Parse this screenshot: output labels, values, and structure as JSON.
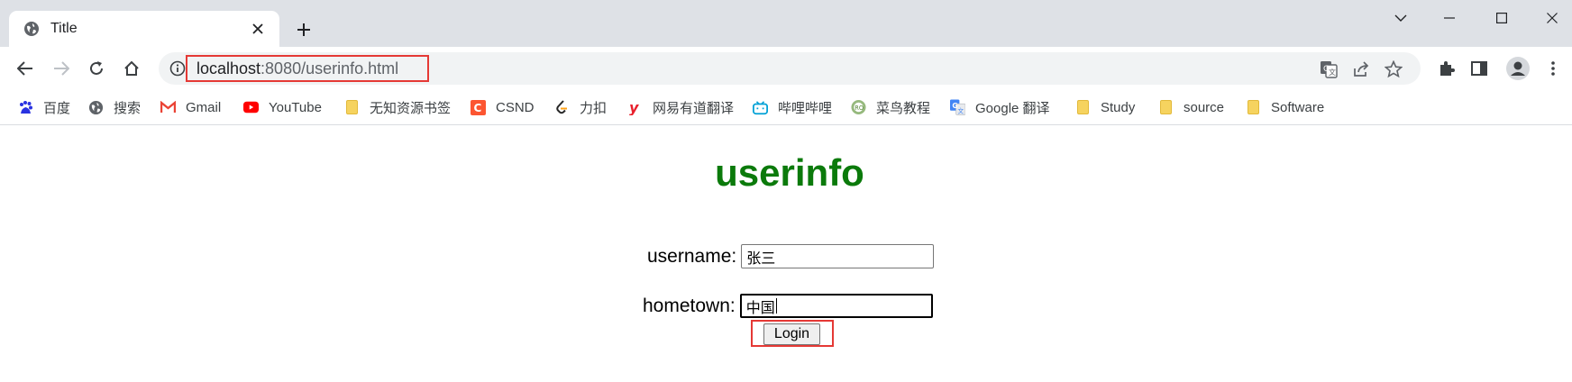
{
  "tab": {
    "title": "Title"
  },
  "address_bar": {
    "host": "localhost",
    "rest": ":8080/userinfo.html"
  },
  "bookmarks": [
    {
      "label": "百度",
      "icon": "baidu-icon"
    },
    {
      "label": "搜索",
      "icon": "globe-icon"
    },
    {
      "label": "Gmail",
      "icon": "gmail-icon"
    },
    {
      "label": "YouTube",
      "icon": "youtube-icon"
    },
    {
      "label": "无知资源书签",
      "icon": "folder-icon"
    },
    {
      "label": "CSND",
      "icon": "csdn-icon"
    },
    {
      "label": "力扣",
      "icon": "leetcode-icon"
    },
    {
      "label": "网易有道翻译",
      "icon": "youdao-icon"
    },
    {
      "label": "哔哩哔哩",
      "icon": "bilibili-icon"
    },
    {
      "label": "菜鸟教程",
      "icon": "runoob-icon"
    },
    {
      "label": "Google 翻译",
      "icon": "google-translate-icon"
    },
    {
      "label": "Study",
      "icon": "folder-icon"
    },
    {
      "label": "source",
      "icon": "folder-icon"
    },
    {
      "label": "Software",
      "icon": "folder-icon"
    }
  ],
  "page": {
    "heading": "userinfo",
    "username_label": "username:",
    "username_value": "张三",
    "hometown_label": "hometown:",
    "hometown_value": "中国",
    "login_label": "Login"
  },
  "colors": {
    "heading": "#0b7a0b",
    "highlight": "#e53935",
    "chrome": "#dee1e6"
  }
}
